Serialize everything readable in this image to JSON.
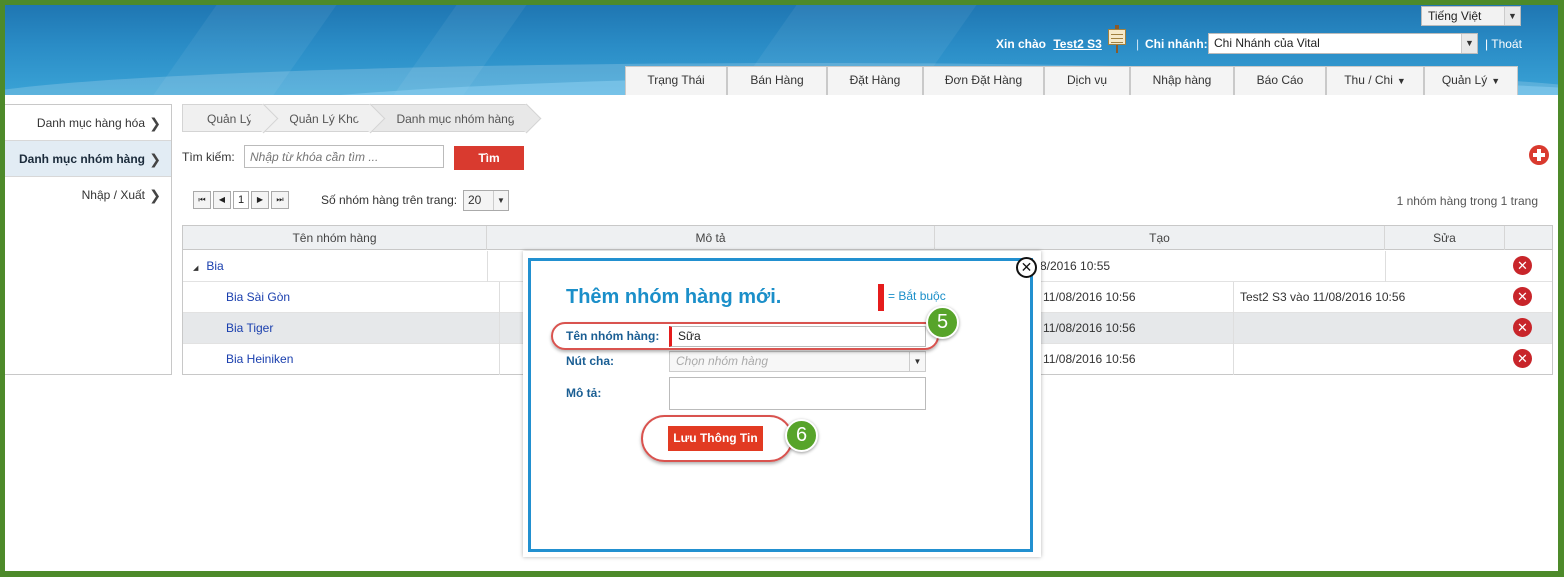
{
  "header": {
    "language": "Tiếng Việt",
    "greeting": "Xin chào",
    "user": "Test2 S3",
    "separator": "|",
    "branch_label": "Chi nhánh:",
    "branch_value": "Chi Nhánh của Vital",
    "logout": "| Thoát",
    "tabs": [
      {
        "label": "Trạng Thái",
        "dropdown": false
      },
      {
        "label": "Bán Hàng",
        "dropdown": false
      },
      {
        "label": "Đặt Hàng",
        "dropdown": false
      },
      {
        "label": "Đơn Đặt Hàng",
        "dropdown": false
      },
      {
        "label": "Dịch vụ",
        "dropdown": false
      },
      {
        "label": "Nhập hàng",
        "dropdown": false
      },
      {
        "label": "Báo Cáo",
        "dropdown": false
      },
      {
        "label": "Thu / Chi",
        "dropdown": true
      },
      {
        "label": "Quản Lý",
        "dropdown": true
      }
    ],
    "dropdown_glyph": "▼"
  },
  "sidebar": {
    "items": [
      {
        "label": "Danh mục hàng hóa",
        "active": false
      },
      {
        "label": "Danh mục nhóm hàng",
        "active": true
      },
      {
        "label": "Nhập / Xuất",
        "active": false
      }
    ]
  },
  "breadcrumb": [
    "Quản Lý",
    "Quản Lý Kho",
    "Danh mục nhóm hàng"
  ],
  "search": {
    "label": "Tìm kiếm:",
    "placeholder": "Nhập từ khóa cần tìm ...",
    "button": "Tìm"
  },
  "pager": {
    "current_page": "1",
    "per_page_label": "Số nhóm hàng trên trang:",
    "per_page_value": "20",
    "info": "1 nhóm hàng trong 1 trang"
  },
  "table": {
    "columns": [
      "Tên nhóm hàng",
      "Mô tả",
      "Tạo",
      "Sửa"
    ],
    "rows": [
      {
        "name": "Bia",
        "created": "8/2016 10:55",
        "edited": "",
        "expander": "◢"
      },
      {
        "name": "Bia Sài Gòn",
        "created": "11/08/2016 10:56",
        "edited": "Test2 S3 vào 11/08/2016 10:56"
      },
      {
        "name": "Bia Tiger",
        "created": "11/08/2016 10:56",
        "edited": ""
      },
      {
        "name": "Bia Heiniken",
        "created": "11/08/2016 10:56",
        "edited": ""
      }
    ]
  },
  "modal": {
    "title": "Thêm nhóm hàng mới.",
    "required_note": "= Bắt buộc",
    "fields": {
      "name_label": "Tên nhóm hàng:",
      "name_value": "Sữa",
      "parent_label": "Nút cha:",
      "parent_placeholder": "Chọn nhóm hàng",
      "desc_label": "Mô tả:"
    },
    "save_button": "Lưu Thông Tin",
    "close_glyph": "✕"
  },
  "annotations": [
    {
      "number": "5",
      "target": "name field"
    },
    {
      "number": "6",
      "target": "save button"
    }
  ],
  "colors": {
    "accent": "#1b8fc9",
    "primary_button": "#d93a2f",
    "callout": "#d9534f",
    "badge": "#57a42a",
    "frame": "#4d8a2a"
  }
}
